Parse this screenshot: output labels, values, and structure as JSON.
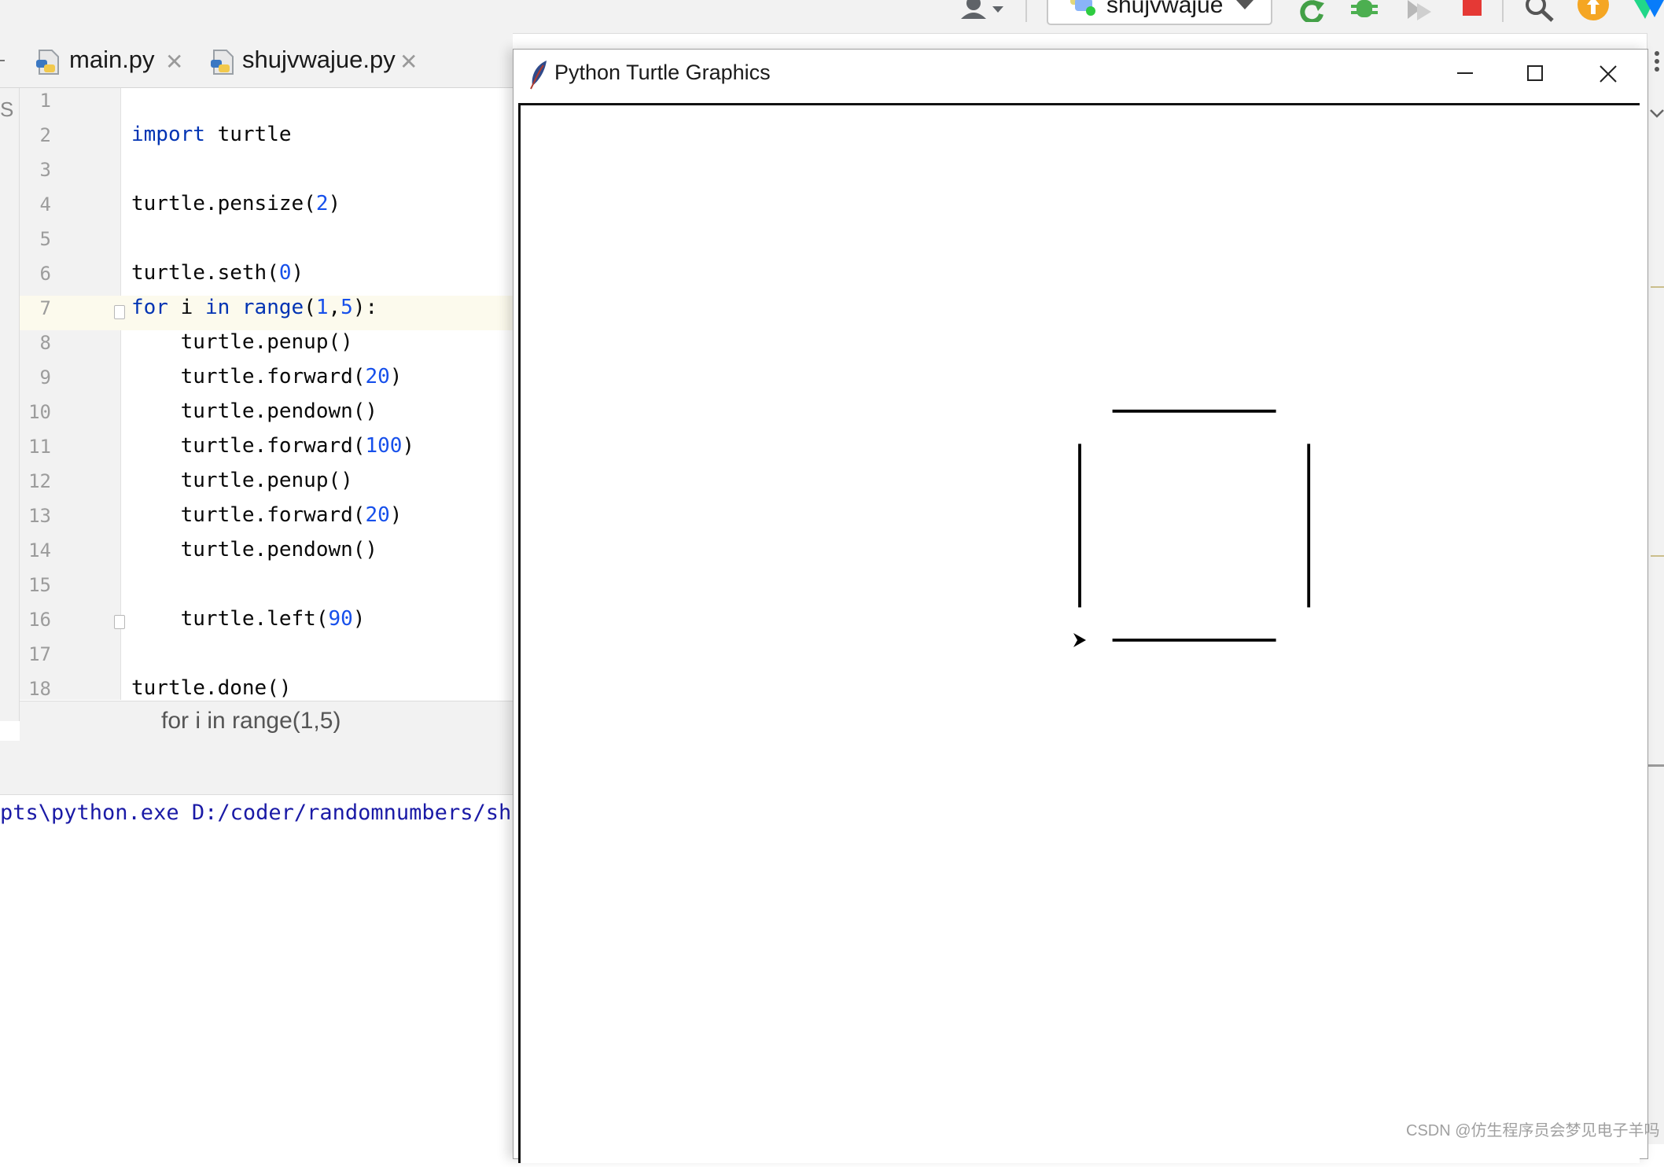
{
  "toolbar": {
    "run_config_name": "shujvwajue",
    "icons": [
      "user-icon",
      "run-config-icon",
      "rerun-icon",
      "debug-icon",
      "coverage-icon",
      "stop-icon",
      "search-icon",
      "update-icon",
      "plugin-icon"
    ],
    "colors": {
      "stop": "#e53935",
      "rerun": "#43a047",
      "debug": "#4caf50",
      "update": "#f5a623"
    }
  },
  "tabs": [
    {
      "label": "main.py",
      "active": false
    },
    {
      "label": "shujvwajue.py",
      "active": true
    }
  ],
  "left_strip_label": "S",
  "editor": {
    "lines": [
      {
        "n": "1",
        "code": ""
      },
      {
        "n": "2",
        "code": "import turtle"
      },
      {
        "n": "3",
        "code": ""
      },
      {
        "n": "4",
        "code": "turtle.pensize(2)"
      },
      {
        "n": "5",
        "code": ""
      },
      {
        "n": "6",
        "code": "turtle.seth(0)"
      },
      {
        "n": "7",
        "code": "for i in range(1,5):"
      },
      {
        "n": "8",
        "code": "    turtle.penup()"
      },
      {
        "n": "9",
        "code": "    turtle.forward(20)"
      },
      {
        "n": "10",
        "code": "    turtle.pendown()"
      },
      {
        "n": "11",
        "code": "    turtle.forward(100)"
      },
      {
        "n": "12",
        "code": "    turtle.penup()"
      },
      {
        "n": "13",
        "code": "    turtle.forward(20)"
      },
      {
        "n": "14",
        "code": "    turtle.pendown()"
      },
      {
        "n": "15",
        "code": ""
      },
      {
        "n": "16",
        "code": "    turtle.left(90)"
      },
      {
        "n": "17",
        "code": ""
      },
      {
        "n": "18",
        "code": "turtle.done()"
      }
    ],
    "keyword_color": "#0033b3",
    "number_color": "#1750eb"
  },
  "breadcrumb": "for i in range(1,5)",
  "console": {
    "line": "pts\\python.exe D:/coder/randomnumbers/shuj"
  },
  "turtle_window": {
    "title": "Python Turtle Graphics",
    "icons": [
      "feather-icon",
      "minimize-icon",
      "maximize-icon",
      "close-icon"
    ],
    "drawing": {
      "pensize": 2,
      "gap": 20,
      "segment": 100,
      "sides": 4,
      "heading": 0
    }
  },
  "watermark": "CSDN @仿生程序员会梦见电子羊吗"
}
